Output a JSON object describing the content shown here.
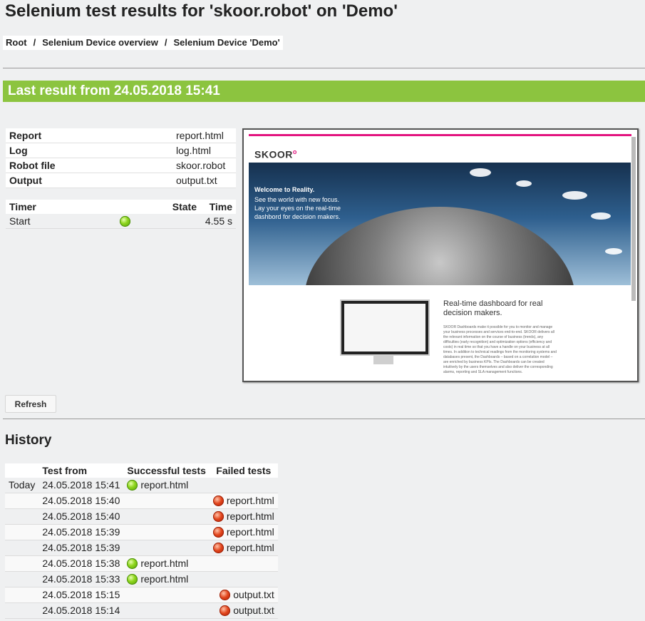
{
  "page": {
    "title": "Selenium test results for 'skoor.robot' on 'Demo'"
  },
  "breadcrumb": [
    "Root",
    "Selenium Device overview",
    "Selenium Device 'Demo'"
  ],
  "banner": {
    "text": "Last result from 24.05.2018 15:41",
    "color": "#8cc43f"
  },
  "files": [
    {
      "label": "Report",
      "value": "report.html"
    },
    {
      "label": "Log",
      "value": "log.html"
    },
    {
      "label": "Robot file",
      "value": "skoor.robot"
    },
    {
      "label": "Output",
      "value": "output.txt"
    }
  ],
  "timer": {
    "headers": {
      "timer": "Timer",
      "state": "State",
      "time": "Time"
    },
    "rows": [
      {
        "name": "Start",
        "state": "ok",
        "time": "4.55 s"
      }
    ]
  },
  "screenshot": {
    "logo": "SKOOR",
    "hero_title": "Welcome to Reality.",
    "hero_sub": "See the world with new focus. Lay your eyes on the real-time dashbord for decision makers.",
    "section_title": "Real-time dashboard for real decision makers.",
    "section_body": "SKOOR Dashboards make it possible for you to monitor and manage your business processes and services end-to-end. SKOOR delivers all the relevant information on the course of business (trends), any difficulties (early recognition) and optimization options (efficiency and costs) in real time so that you have a handle on your business at all times. In addition to technical readings from the monitoring systems and databases present, the Dashboards – based on a correlation model – are enriched by business KPIs. The Dashboards can be created intuitively by the users themselves and also deliver the corresponding alarms, reporting and SLA management functions."
  },
  "refresh": {
    "label": "Refresh"
  },
  "history": {
    "title": "History",
    "headers": {
      "day": "",
      "test_from": "Test from",
      "successful": "Successful tests",
      "failed": "Failed tests"
    },
    "rows": [
      {
        "day": "Today",
        "time": "24.05.2018 15:41",
        "success": "report.html",
        "failed": ""
      },
      {
        "day": "",
        "time": "24.05.2018 15:40",
        "success": "",
        "failed": "report.html"
      },
      {
        "day": "",
        "time": "24.05.2018 15:40",
        "success": "",
        "failed": "report.html"
      },
      {
        "day": "",
        "time": "24.05.2018 15:39",
        "success": "",
        "failed": "report.html"
      },
      {
        "day": "",
        "time": "24.05.2018 15:39",
        "success": "",
        "failed": "report.html"
      },
      {
        "day": "",
        "time": "24.05.2018 15:38",
        "success": "report.html",
        "failed": ""
      },
      {
        "day": "",
        "time": "24.05.2018 15:33",
        "success": "report.html",
        "failed": ""
      },
      {
        "day": "",
        "time": "24.05.2018 15:15",
        "success": "",
        "failed": "output.txt"
      },
      {
        "day": "",
        "time": "24.05.2018 15:14",
        "success": "",
        "failed": "output.txt"
      }
    ]
  }
}
